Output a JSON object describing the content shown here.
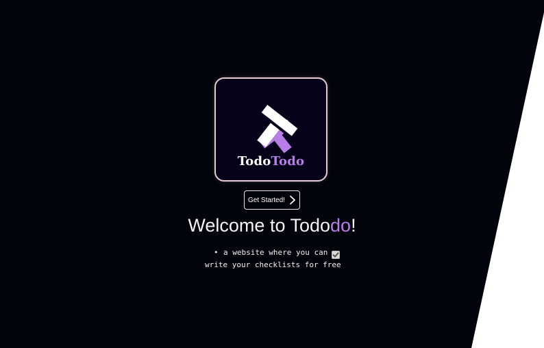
{
  "brand": {
    "logo_part1": "Todo",
    "logo_part2": "Todo",
    "accent_color": "#b77ee8",
    "card_border_color": "#e8c9d6",
    "background_color": "#01040a"
  },
  "cta": {
    "label": "Get Started!",
    "icon": "chevron-right-icon"
  },
  "headline": {
    "prefix": "Welcome to Todo",
    "accent": "do",
    "suffix": "!"
  },
  "tagline": {
    "bullet": "•",
    "line1": "a website where you can",
    "line2": "write your checklists for free",
    "checkbox_checked": true,
    "checkbox_icon": "checkmark-icon"
  }
}
